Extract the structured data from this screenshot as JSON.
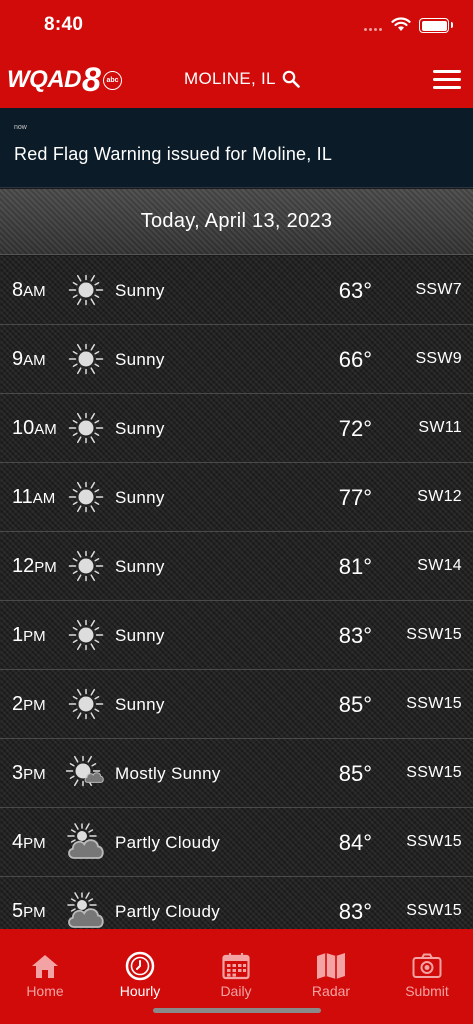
{
  "status_bar": {
    "time": "8:40"
  },
  "header": {
    "logo_word": "WQAD",
    "logo_number": "8",
    "logo_network": "abc",
    "location": "MOLINE, IL"
  },
  "alert": {
    "timestamp": "now",
    "message": "Red Flag Warning issued for Moline, IL"
  },
  "date_header": "Today, April 13, 2023",
  "hourly": [
    {
      "hour": "8",
      "period": "AM",
      "icon": "sunny-icon",
      "condition": "Sunny",
      "temp": "63°",
      "wind": "SSW7"
    },
    {
      "hour": "9",
      "period": "AM",
      "icon": "sunny-icon",
      "condition": "Sunny",
      "temp": "66°",
      "wind": "SSW9"
    },
    {
      "hour": "10",
      "period": "AM",
      "icon": "sunny-icon",
      "condition": "Sunny",
      "temp": "72°",
      "wind": "SW11"
    },
    {
      "hour": "11",
      "period": "AM",
      "icon": "sunny-icon",
      "condition": "Sunny",
      "temp": "77°",
      "wind": "SW12"
    },
    {
      "hour": "12",
      "period": "PM",
      "icon": "sunny-icon",
      "condition": "Sunny",
      "temp": "81°",
      "wind": "SW14"
    },
    {
      "hour": "1",
      "period": "PM",
      "icon": "sunny-icon",
      "condition": "Sunny",
      "temp": "83°",
      "wind": "SSW15"
    },
    {
      "hour": "2",
      "period": "PM",
      "icon": "sunny-icon",
      "condition": "Sunny",
      "temp": "85°",
      "wind": "SSW15"
    },
    {
      "hour": "3",
      "period": "PM",
      "icon": "mostly-sunny-icon",
      "condition": "Mostly Sunny",
      "temp": "85°",
      "wind": "SSW15"
    },
    {
      "hour": "4",
      "period": "PM",
      "icon": "partly-cloudy-icon",
      "condition": "Partly Cloudy",
      "temp": "84°",
      "wind": "SSW15"
    },
    {
      "hour": "5",
      "period": "PM",
      "icon": "partly-cloudy-icon",
      "condition": "Partly Cloudy",
      "temp": "83°",
      "wind": "SSW15"
    }
  ],
  "tabs": [
    {
      "label": "Home",
      "icon": "home-icon",
      "active": false
    },
    {
      "label": "Hourly",
      "icon": "clock-icon",
      "active": true
    },
    {
      "label": "Daily",
      "icon": "calendar-icon",
      "active": false
    },
    {
      "label": "Radar",
      "icon": "map-icon",
      "active": false
    },
    {
      "label": "Submit",
      "icon": "camera-icon",
      "active": false
    }
  ],
  "colors": {
    "brand_red": "#d10a0a",
    "alert_bg": "#0c1b28",
    "inactive_tab": "#f3a3a3"
  }
}
